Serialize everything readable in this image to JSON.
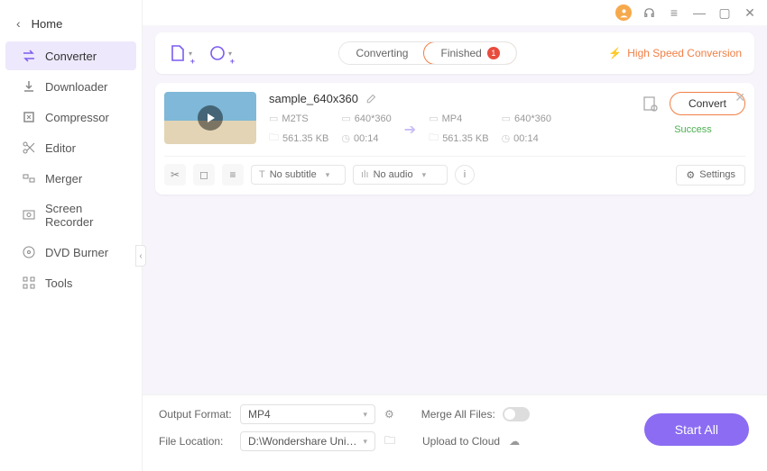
{
  "sidebar": {
    "home": "Home",
    "items": [
      {
        "label": "Converter"
      },
      {
        "label": "Downloader"
      },
      {
        "label": "Compressor"
      },
      {
        "label": "Editor"
      },
      {
        "label": "Merger"
      },
      {
        "label": "Screen Recorder"
      },
      {
        "label": "DVD Burner"
      },
      {
        "label": "Tools"
      }
    ]
  },
  "toolbar": {
    "tabs": {
      "converting": "Converting",
      "finished": "Finished",
      "finished_count": "1"
    },
    "high_speed": "High Speed Conversion"
  },
  "file": {
    "name": "sample_640x360",
    "source": {
      "codec": "M2TS",
      "resolution": "640*360",
      "size": "561.35 KB",
      "duration": "00:14"
    },
    "target": {
      "codec": "MP4",
      "resolution": "640*360",
      "size": "561.35 KB",
      "duration": "00:14"
    },
    "convert_label": "Convert",
    "status": "Success",
    "subtitle_dd": "No subtitle",
    "audio_dd": "No audio",
    "settings_label": "Settings"
  },
  "footer": {
    "output_format_label": "Output Format:",
    "output_format_value": "MP4",
    "file_location_label": "File Location:",
    "file_location_value": "D:\\Wondershare UniConverter 1",
    "merge_label": "Merge All Files:",
    "upload_label": "Upload to Cloud",
    "start_all": "Start All"
  }
}
